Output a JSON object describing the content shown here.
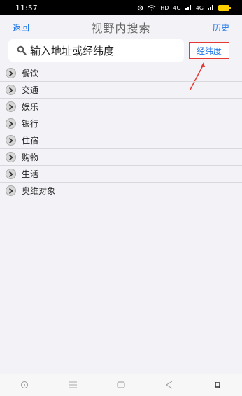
{
  "status_bar": {
    "time": "11:57",
    "net_label": "HD",
    "signal1_label": "4G",
    "signal2_label": "4G"
  },
  "nav": {
    "back_label": "返回",
    "title": "视野内搜索",
    "history_label": "历史"
  },
  "search": {
    "placeholder": "输入地址或经纬度",
    "coord_button_label": "经纬度"
  },
  "categories": [
    {
      "label": "餐饮"
    },
    {
      "label": "交通"
    },
    {
      "label": "娱乐"
    },
    {
      "label": "银行"
    },
    {
      "label": "住宿"
    },
    {
      "label": "购物"
    },
    {
      "label": "生活"
    },
    {
      "label": "奥维对象"
    }
  ],
  "colors": {
    "accent": "#1a73e8",
    "highlight_border": "#e53935",
    "background": "#f2f2f7"
  }
}
